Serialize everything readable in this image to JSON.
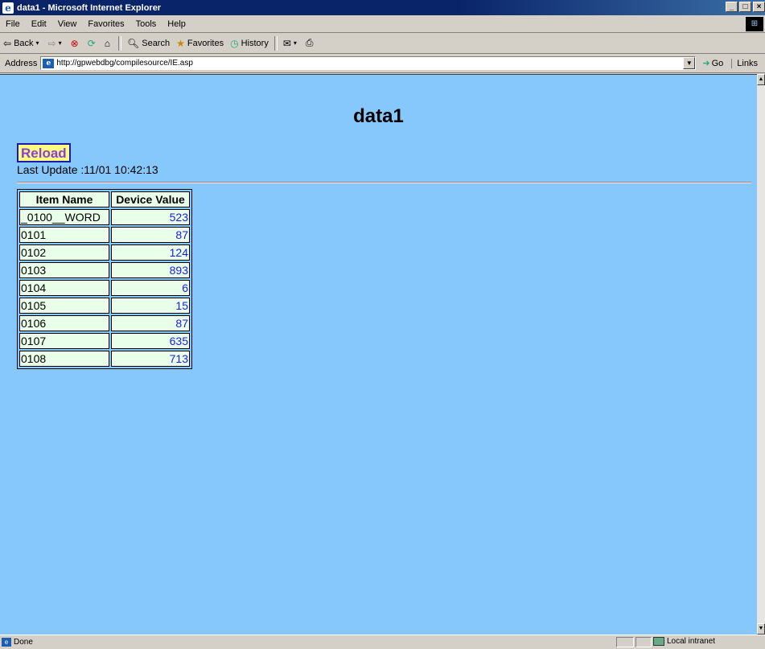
{
  "window": {
    "title": "data1 - Microsoft Internet Explorer",
    "buttons": [
      "_",
      "□",
      "×"
    ]
  },
  "menu": [
    {
      "label": "File"
    },
    {
      "label": "Edit"
    },
    {
      "label": "View"
    },
    {
      "label": "Favorites"
    },
    {
      "label": "Tools"
    },
    {
      "label": "Help"
    }
  ],
  "toolbar": {
    "back": "Back",
    "search": "Search",
    "favorites": "Favorites",
    "history": "History"
  },
  "address": {
    "label": "Address",
    "url": "http://gpwebdbg/compilesource/IE.asp",
    "go": "Go",
    "links": "Links"
  },
  "page": {
    "title": "data1",
    "reload_label": "Reload",
    "last_update": "Last Update :11/01 10:42:13",
    "table": {
      "headers": [
        "Item Name",
        "Device Value"
      ],
      "rows": [
        {
          "name": "_0100__WORD",
          "value": "523"
        },
        {
          "name": "0101",
          "value": "87"
        },
        {
          "name": "0102",
          "value": "124"
        },
        {
          "name": "0103",
          "value": "893"
        },
        {
          "name": "0104",
          "value": "6"
        },
        {
          "name": "0105",
          "value": "15"
        },
        {
          "name": "0106",
          "value": "87"
        },
        {
          "name": "0107",
          "value": "635"
        },
        {
          "name": "0108",
          "value": "713"
        }
      ]
    }
  },
  "status": {
    "text": "Done",
    "zone": "Local intranet"
  },
  "colors": {
    "page_background": "#87c8fc",
    "cell_background": "#eaffea",
    "value_text": "#1a1af0",
    "reload_background": "#fcfc80",
    "reload_text": "#8b3fd6"
  }
}
